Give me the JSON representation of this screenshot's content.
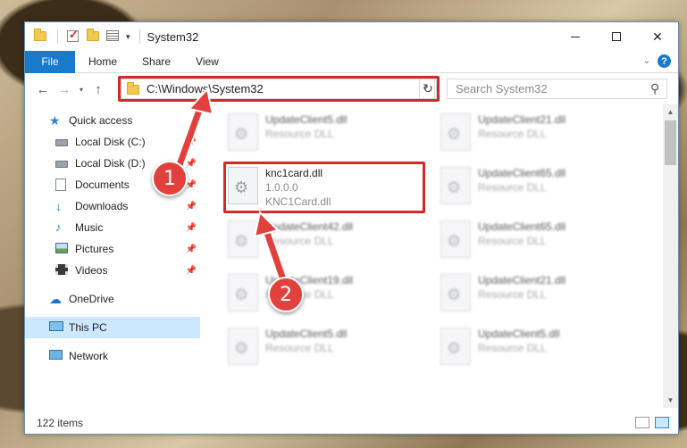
{
  "window": {
    "title": "System32",
    "min_icon": "minimize-icon",
    "max_icon": "maximize-icon",
    "close_label": "✕"
  },
  "ribbon": {
    "tabs": [
      "File",
      "Home",
      "Share",
      "View"
    ],
    "help": "?"
  },
  "nav": {
    "back": "←",
    "forward": "→",
    "up": "↑",
    "address": "C:\\Windows\\System32",
    "search_placeholder": "Search System32"
  },
  "sidebar": {
    "items": [
      {
        "label": "Quick access",
        "icon": "star-icon",
        "pinned": false
      },
      {
        "label": "Local Disk (C:)",
        "icon": "disk-icon",
        "pinned": true
      },
      {
        "label": "Local Disk (D:)",
        "icon": "disk-icon",
        "pinned": true
      },
      {
        "label": "Documents",
        "icon": "documents-icon",
        "pinned": true
      },
      {
        "label": "Downloads",
        "icon": "downloads-icon",
        "pinned": true
      },
      {
        "label": "Music",
        "icon": "music-icon",
        "pinned": true
      },
      {
        "label": "Pictures",
        "icon": "pictures-icon",
        "pinned": true
      },
      {
        "label": "Videos",
        "icon": "videos-icon",
        "pinned": true
      },
      {
        "label": "OneDrive",
        "icon": "onedrive-icon",
        "pinned": false
      },
      {
        "label": "This PC",
        "icon": "this-pc-icon",
        "pinned": false,
        "selected": true
      },
      {
        "label": "Network",
        "icon": "network-icon",
        "pinned": false
      }
    ]
  },
  "files": {
    "left": [
      {
        "name": "UpdateClient5.dll",
        "desc": "Resource DLL"
      },
      {
        "name": "knc1card.dll",
        "desc": "1.0.0.0",
        "extra": "KNC1Card.dll",
        "highlighted": true
      },
      {
        "name": "UpdateClient42.dll",
        "desc": "Resource DLL"
      },
      {
        "name": "UpdateClient19.dll",
        "desc": "Resource DLL"
      },
      {
        "name": "UpdateClient5.dll",
        "desc": "Resource DLL"
      }
    ],
    "right": [
      {
        "name": "UpdateClient21.dll",
        "desc": "Resource DLL"
      },
      {
        "name": "UpdateClient65.dll",
        "desc": "Resource DLL"
      },
      {
        "name": "UpdateClient65.dll",
        "desc": "Resource DLL"
      },
      {
        "name": "UpdateClient21.dll",
        "desc": "Resource DLL"
      },
      {
        "name": "UpdateClient5.dll",
        "desc": "Resource DLL"
      }
    ]
  },
  "status": {
    "item_count": "122 items"
  },
  "callouts": [
    "1",
    "2"
  ],
  "colors": {
    "accent": "#1979ca",
    "highlight": "#d72828",
    "callout": "#e2403d"
  }
}
